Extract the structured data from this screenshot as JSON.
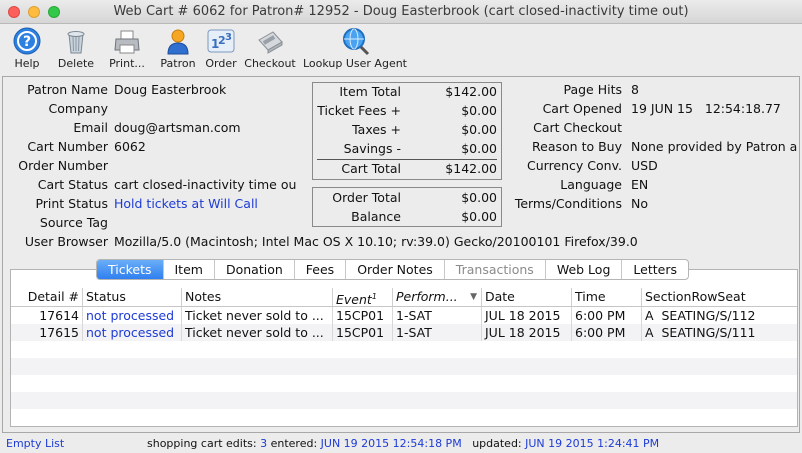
{
  "window": {
    "title": "Web Cart # 6062 for Patron# 12952 - Doug Easterbrook (cart closed-inactivity time out)",
    "close_color": "#fc605c",
    "minimize_color": "#fdbc40",
    "zoom_color": "#34c84a"
  },
  "toolbar": {
    "items": [
      {
        "label": "Help",
        "icon": "help-icon"
      },
      {
        "label": "Delete",
        "icon": "trash-icon"
      },
      {
        "label": "Print...",
        "icon": "printer-icon"
      },
      {
        "label": "Patron",
        "icon": "person-icon"
      },
      {
        "label": "Order",
        "icon": "numbers-icon"
      },
      {
        "label": "Checkout",
        "icon": "card-reader-icon"
      },
      {
        "label": "Lookup User Agent",
        "icon": "magnifier-globe-icon"
      }
    ]
  },
  "details": {
    "patron_name_label": "Patron Name",
    "patron_name": "Doug Easterbrook",
    "company_label": "Company",
    "company": "",
    "email_label": "Email",
    "email": "doug@artsman.com",
    "cart_number_label": "Cart Number",
    "cart_number": "6062",
    "order_number_label": "Order Number",
    "order_number": "",
    "cart_status_label": "Cart Status",
    "cart_status": "cart closed-inactivity time ou",
    "print_status_label": "Print Status",
    "print_status": "Hold tickets at Will Call",
    "source_tag_label": "Source Tag",
    "source_tag": "",
    "user_browser_label": "User Browser",
    "user_browser": "Mozilla/5.0 (Macintosh; Intel Mac OS X 10.10; rv:39.0) Gecko/20100101 Firefox/39.0"
  },
  "totals": {
    "item_total_label": "Item Total",
    "item_total": "$142.00",
    "ticket_fees_label": "Ticket Fees +",
    "ticket_fees": "$0.00",
    "taxes_label": "Taxes +",
    "taxes": "$0.00",
    "savings_label": "Savings -",
    "savings": "$0.00",
    "cart_total_label": "Cart Total",
    "cart_total": "$142.00",
    "order_total_label": "Order Total",
    "order_total": "$0.00",
    "balance_label": "Balance",
    "balance": "$0.00"
  },
  "right_info": {
    "page_hits_label": "Page Hits",
    "page_hits": "8",
    "cart_opened_label": "Cart Opened",
    "cart_opened": "19 JUN 15   12:54:18.77",
    "cart_checkout_label": "Cart Checkout",
    "cart_checkout": "",
    "reason_label": "Reason to Buy",
    "reason": "None provided by Patron a",
    "currency_label": "Currency Conv.",
    "currency": "USD",
    "language_label": "Language",
    "language": "EN",
    "terms_label": "Terms/Conditions",
    "terms": "No"
  },
  "tabs": [
    {
      "label": "Tickets",
      "state": "active"
    },
    {
      "label": "Item",
      "state": "normal"
    },
    {
      "label": "Donation",
      "state": "normal"
    },
    {
      "label": "Fees",
      "state": "normal"
    },
    {
      "label": "Order Notes",
      "state": "normal"
    },
    {
      "label": "Transactions",
      "state": "disabled"
    },
    {
      "label": "Web Log",
      "state": "normal"
    },
    {
      "label": "Letters",
      "state": "normal"
    }
  ],
  "table": {
    "columns": [
      "Detail #",
      "Status",
      "Notes",
      "Event",
      "Perform...",
      "Date",
      "Time",
      "SectionRowSeat"
    ],
    "event_superscript": "1",
    "rows": [
      {
        "detail": "17614",
        "status": "not processed",
        "notes": "Ticket never sold to ...",
        "event": "15CP01",
        "perform": "1-SAT",
        "date": "JUL 18 2015",
        "time": "6:00 PM",
        "seat": "A  SEATING/S/112"
      },
      {
        "detail": "17615",
        "status": "not processed",
        "notes": "Ticket never sold to ...",
        "event": "15CP01",
        "perform": "1-SAT",
        "date": "JUL 18 2015",
        "time": "6:00 PM",
        "seat": "A  SEATING/S/111"
      }
    ]
  },
  "status_bar": {
    "empty_list": "Empty List",
    "edits_label": "shopping cart edits:",
    "edits": "3",
    "entered_label": "entered:",
    "entered": "JUN 19 2015 12:54:18 PM",
    "updated_label": "updated:",
    "updated": "JUN 19 2015 1:24:41 PM"
  }
}
